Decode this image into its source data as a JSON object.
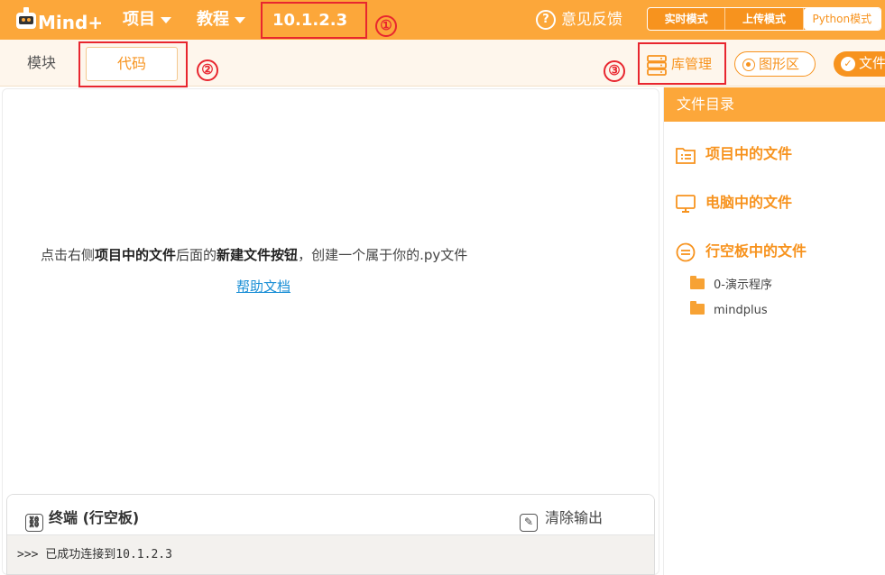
{
  "app": {
    "logo_text": "Mind+"
  },
  "topbar": {
    "project_menu": "项目",
    "tutorial_menu": "教程",
    "device_ip": "10.1.2.3",
    "feedback": "意见反馈",
    "modes": [
      "实时模式",
      "上传模式",
      "Python模式"
    ],
    "active_mode": "Python模式"
  },
  "annotations": [
    "①",
    "②",
    "③"
  ],
  "subbar": {
    "tab_blocks": "模块",
    "tab_code": "代码",
    "library_manager": "库管理",
    "graphic_area": "图形区",
    "files": "文件"
  },
  "editor": {
    "hint_prefix": "点击右侧",
    "hint_bold1": "项目中的文件",
    "hint_middle": "后面的",
    "hint_bold2": "新建文件按钮",
    "hint_suffix": "，创建一个属于你的.py文件",
    "help_link": "帮助文档"
  },
  "terminal": {
    "title": "终端 (行空板)",
    "clear": "清除输出",
    "output": ">>> 已成功连接到10.1.2.3"
  },
  "sidebar": {
    "header": "文件目录",
    "project_files": "项目中的文件",
    "computer_files": "电脑中的文件",
    "board_files": "行空板中的文件",
    "folders": [
      "0-演示程序",
      "mindplus"
    ]
  },
  "colors": {
    "brand": "#fca73a",
    "accent": "#f7931e",
    "annotation": "#e8262f",
    "link": "#1a8fd6"
  }
}
